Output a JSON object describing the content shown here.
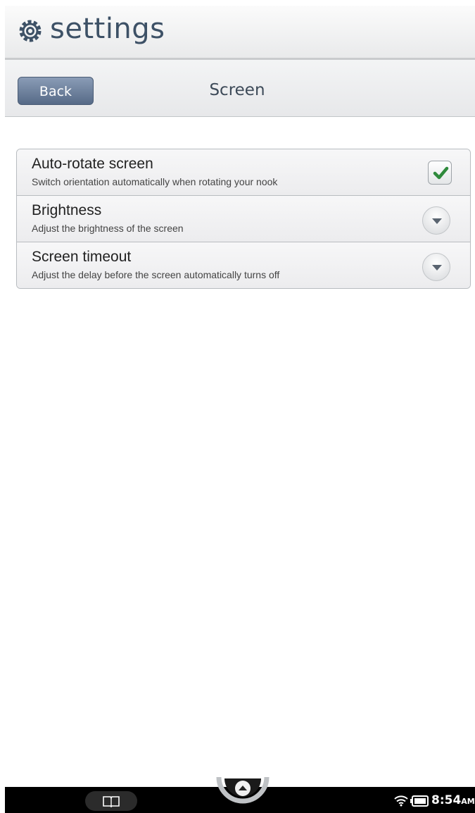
{
  "app": {
    "title": "settings",
    "title_icon": "gear-icon"
  },
  "header": {
    "back_label": "Back",
    "title": "Screen"
  },
  "settings": [
    {
      "title": "Auto-rotate screen",
      "subtitle": "Switch orientation automatically when rotating your nook",
      "control": "checkbox",
      "checked": true
    },
    {
      "title": "Brightness",
      "subtitle": "Adjust the brightness of the screen",
      "control": "dropdown"
    },
    {
      "title": "Screen timeout",
      "subtitle": "Adjust the delay before the screen automatically turns off",
      "control": "dropdown"
    }
  ],
  "statusbar": {
    "time": "8:54",
    "ampm": "AM",
    "icons": [
      "wifi-icon",
      "battery-icon"
    ]
  },
  "navbar": {
    "icons": [
      "library-icon",
      "home-up-arrow-icon"
    ]
  },
  "colors": {
    "title_text": "#3d5166",
    "back_button": "#566a87",
    "check": "#2f8a3c"
  }
}
